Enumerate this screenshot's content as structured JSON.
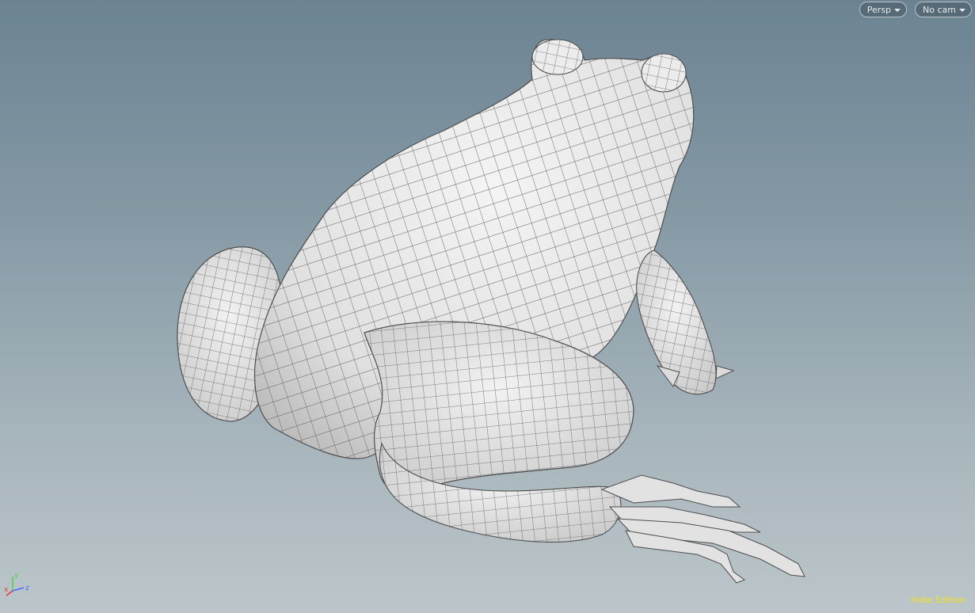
{
  "viewport": {
    "camera_menu": {
      "label": "Persp",
      "icon": "caret-down-icon"
    },
    "cam_select_menu": {
      "label": "No cam",
      "icon": "caret-down-icon"
    },
    "axis_gizmo": {
      "x": "x",
      "y": "y",
      "z": "z",
      "x_color": "#e03c3c",
      "y_color": "#4fd24f",
      "z_color": "#4a6cff"
    },
    "edition_label": "Indie Edition",
    "model": {
      "name": "frog-mesh",
      "shading": "wireframe-on-shaded",
      "surface_color": "#e9e9e9",
      "wire_color": "#5b5b5b"
    }
  }
}
